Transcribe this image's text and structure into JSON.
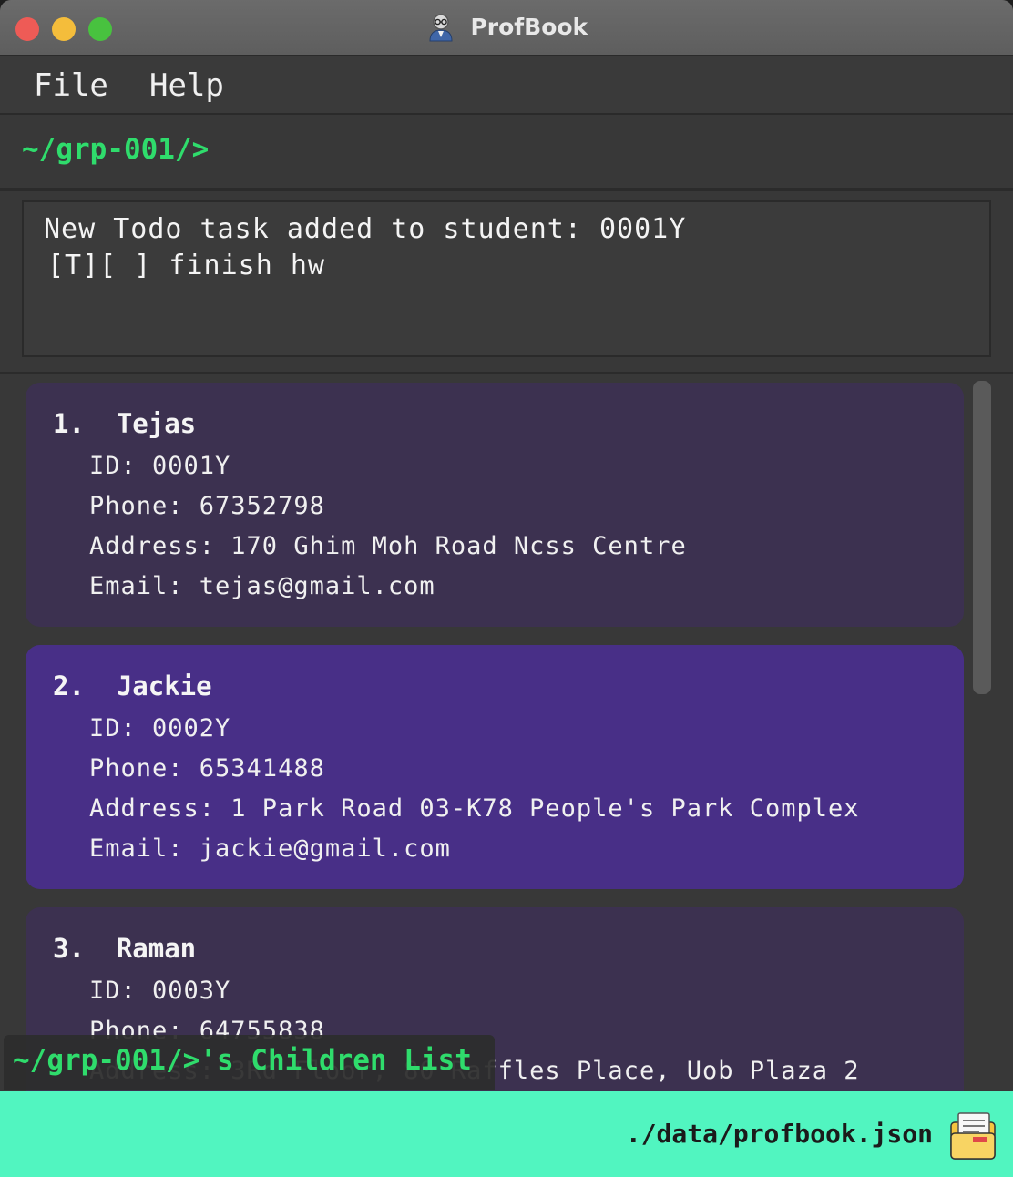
{
  "window": {
    "title": "ProfBook"
  },
  "menu": {
    "items": [
      "File",
      "Help"
    ]
  },
  "command": {
    "prompt": "~/grp-001/>"
  },
  "result": {
    "lines": [
      "New Todo task added to student: 0001Y",
      "[T][ ] finish hw"
    ]
  },
  "students": [
    {
      "index": "1.",
      "name": "Tejas",
      "id": "ID: 0001Y",
      "phone": "Phone: 67352798",
      "address": "Address: 170 Ghim Moh Road Ncss Centre",
      "email": "Email: tejas@gmail.com"
    },
    {
      "index": "2.",
      "name": "Jackie",
      "id": "ID: 0002Y",
      "phone": "Phone: 65341488",
      "address": "Address: 1 Park Road 03-K78 People's Park Complex",
      "email": "Email: jackie@gmail.com"
    },
    {
      "index": "3.",
      "name": "Raman",
      "id": "ID: 0003Y",
      "phone": "Phone: 64755838",
      "address": "Address: 3Rd Floor, 80 Raffles Place, Uob Plaza 2",
      "email": ""
    }
  ],
  "list": {
    "heading": "~/grp-001/>'s Children List"
  },
  "status": {
    "file_path": "./data/profbook.json"
  },
  "colors": {
    "accent_green": "#2fdc6c",
    "status_bar": "#51f5c0",
    "card": "#3c3150",
    "card_selected": "#482f87"
  },
  "icons": {
    "app": "professor-avatar-icon",
    "status": "folder-file-icon"
  }
}
